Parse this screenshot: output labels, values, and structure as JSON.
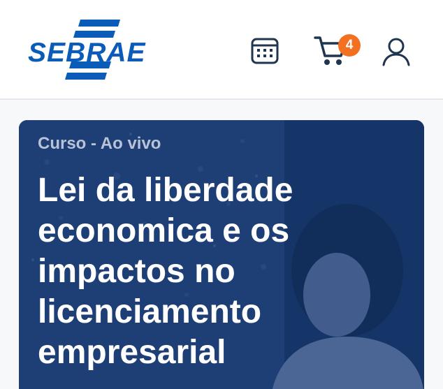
{
  "header": {
    "logo": {
      "text": "SEBRAE",
      "color": "#0b5cb8"
    },
    "icons": {
      "calendar": "calendar-icon",
      "cart": "shopping-cart-icon",
      "user": "user-icon"
    },
    "cart_count": "4",
    "accent_badge_color": "#f37021",
    "icon_color": "#1f3550"
  },
  "hero": {
    "kicker": "Curso - Ao vivo",
    "title": "Lei da liberdade economica e os impactos no licenciamento empresarial",
    "overlay_color": "#14346e"
  }
}
